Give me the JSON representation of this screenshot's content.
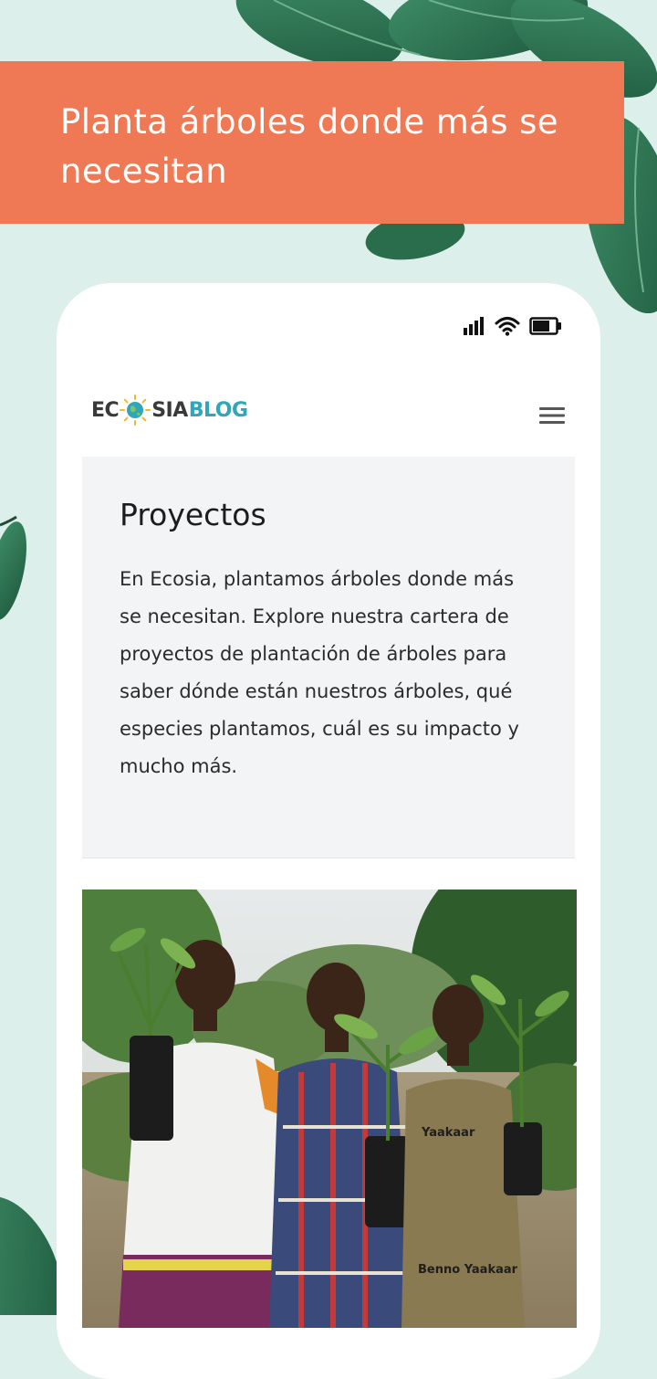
{
  "promo": {
    "headline": "Planta árboles donde más se necesitan"
  },
  "status_bar": {
    "signal_icon": "signal-bars-icon",
    "wifi_icon": "wifi-icon",
    "battery_icon": "battery-icon"
  },
  "header": {
    "logo": {
      "part1": "EC",
      "part2": "SIA",
      "part3": "BLOG"
    },
    "menu_icon": "hamburger-menu-icon"
  },
  "article": {
    "heading": "Proyectos",
    "body": "En Ecosia, plantamos árboles donde más se necesitan. Explore nuestra cartera de proyectos de plantación de árboles para saber dónde están nuestros árboles, qué especies plantamos, cuál es su impacto y mucho más."
  },
  "photo": {
    "shirt_text_1": "Yaakaar",
    "shirt_text_2": "Benno Yaakaar"
  },
  "colors": {
    "background": "#dcefeb",
    "banner": "#ef7855",
    "card": "#f3f4f5",
    "logo_accent": "#2fa6ba",
    "leaf": "#2f7a58"
  }
}
